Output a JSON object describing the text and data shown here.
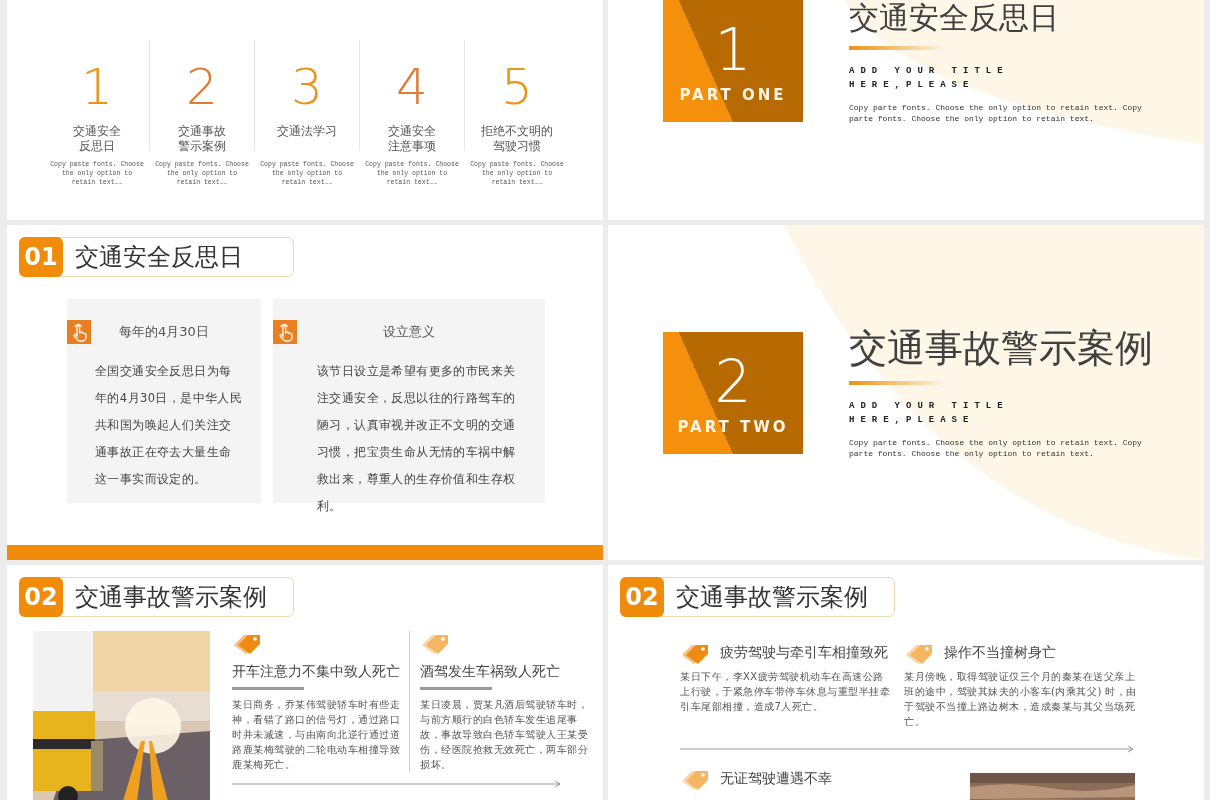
{
  "slides": [
    {
      "kind": "agenda",
      "items": [
        {
          "number": "1",
          "title": [
            "交通安全",
            "反思日"
          ],
          "desc": "Copy paste fonts. Choose the only option to retain text……"
        },
        {
          "number": "2",
          "title": [
            "交通事故",
            "警示案例"
          ],
          "desc": "Copy paste fonts. Choose the only option to retain text……"
        },
        {
          "number": "3",
          "title": [
            "交通法学习"
          ],
          "desc": "Copy paste fonts. Choose the only option to retain text……"
        },
        {
          "number": "4",
          "title": [
            "交通安全",
            "注意事项"
          ],
          "desc": "Copy paste fonts. Choose the only option to retain text……"
        },
        {
          "number": "5",
          "title": [
            "拒绝不文明的",
            "驾驶习惯"
          ],
          "desc": "Copy paste fonts. Choose the only option to retain text……"
        }
      ]
    },
    {
      "kind": "part",
      "number": "1",
      "part_label": "PART ONE",
      "title": "交通安全反思日",
      "subtitle": [
        "ADD YOUR TITLE",
        "HERE,PLEASE"
      ],
      "body": "Copy parte fonts. Choose the only option to retain text. Copy parte fonts. Choose the only option to retain text."
    },
    {
      "kind": "cards",
      "badge": "01",
      "heading": "交通安全反思日",
      "cards": [
        {
          "title": "每年的4月30日",
          "body": "全国交通安全反思日为每年的4月30日，是中华人民共和国为唤起人们关注交通事故正在夺去大量生命这一事实而设定的。"
        },
        {
          "title": "设立意义",
          "body": "该节日设立是希望有更多的市民来关注交通安全，反思以往的行路驾车的陋习，认真审视并改正不文明的交通习惯，把宝贵生命从无情的车祸中解救出来，尊重人的生存价值和生存权利。"
        }
      ]
    },
    {
      "kind": "part",
      "number": "2",
      "part_label": "PART TWO",
      "title": "交通事故警示案例",
      "subtitle": [
        "ADD YOUR TITLE",
        "HERE,PLEASE"
      ],
      "body": "Copy parte fonts. Choose the only option to retain text. Copy parte fonts. Choose the only option to retain text."
    },
    {
      "kind": "cases_photo",
      "badge": "02",
      "heading": "交通事故警示案例",
      "cases": [
        {
          "title": "开车注意力不集中致人死亡",
          "body": "某日商务，乔某伟驾驶轿车时有些走神，看错了路口的信号灯，通过路口时并未减速，与由南向北逆行通过道路鹿某梅驾驶的二轮电动车相撞导致鹿某梅死亡。"
        },
        {
          "title": "酒驾发生车祸致人死亡",
          "body": "某日凌晨，贾某凡酒后驾驶轿车时，与前方顺行的白色轿车发生追尾事故，事故导致白色轿车驾驶人王某受伤，经医院抢救无效死亡，两车部分损坏。"
        }
      ]
    },
    {
      "kind": "cases_grid",
      "badge": "02",
      "heading": "交通事故警示案例",
      "cases": [
        {
          "title": "疲劳驾驶与牵引车相撞致死",
          "body": "某日下午，李XX疲劳驾驶机动车在高速公路上行驶，于紧急停车带停车休息与重型半挂牵引车尾部相撞，造成7人死亡。"
        },
        {
          "title": "操作不当撞树身亡",
          "body": "某月傍晚，取得驾驶证仅三个月的秦某在送父亲上班的途中，驾驶其妹夫的小客车(内乘其父) 时，由于驾驶不当撞上路边树木，造成秦某与其父当场死亡。"
        }
      ],
      "next_case_title": "无证驾驶遭遇不幸"
    }
  ]
}
